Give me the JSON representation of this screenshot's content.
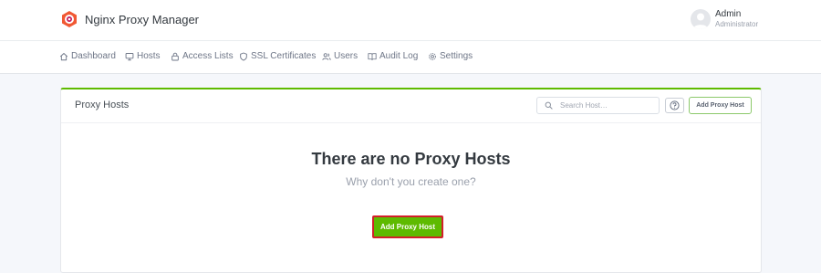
{
  "app": {
    "name": "Nginx Proxy Manager"
  },
  "user": {
    "name": "Admin",
    "role": "Administrator"
  },
  "nav": {
    "items": [
      {
        "label": "Dashboard",
        "icon": "home-icon"
      },
      {
        "label": "Hosts",
        "icon": "monitor-icon"
      },
      {
        "label": "Access Lists",
        "icon": "lock-icon"
      },
      {
        "label": "SSL Certificates",
        "icon": "shield-icon"
      },
      {
        "label": "Users",
        "icon": "users-icon"
      },
      {
        "label": "Audit Log",
        "icon": "book-icon"
      },
      {
        "label": "Settings",
        "icon": "gear-icon"
      }
    ]
  },
  "card": {
    "title": "Proxy Hosts",
    "search_placeholder": "Search Host…",
    "add_button_label": "Add Proxy Host",
    "empty_title": "There are no Proxy Hosts",
    "empty_subtitle": "Why don't you create one?",
    "empty_button_label": "Add Proxy Host"
  },
  "colors": {
    "accent_green": "#5eba00",
    "highlight_red": "#d21f2a",
    "logo_orange": "#f15833"
  }
}
